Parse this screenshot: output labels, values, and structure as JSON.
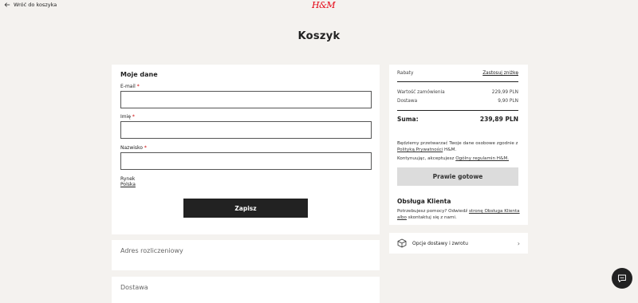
{
  "header": {
    "back_label": "Wróć do koszyka",
    "logo_text": "H&M",
    "page_title": "Koszyk"
  },
  "moje_dane": {
    "title": "Moje dane",
    "email_label": "E-mail",
    "imie_label": "Imię",
    "nazwisko_label": "Nazwisko",
    "required_mark": "*",
    "email_value": "",
    "imie_value": "",
    "nazwisko_value": "",
    "rynek_label": "Rynek",
    "rynek_value": "Polska",
    "save_label": "Zapisz"
  },
  "adres": {
    "title": "Adres rozliczeniowy"
  },
  "dostawa": {
    "title": "Dostawa"
  },
  "summary": {
    "rabaty_label": "Rabaty",
    "rabaty_link": "Zastosuj zniżkę",
    "wartosc_label": "Wartość zamówienia",
    "wartosc_value": "229,99 PLN",
    "dostawa_label": "Dostawa",
    "dostawa_value": "9,90 PLN",
    "suma_label": "Suma:",
    "suma_value": "239,89 PLN",
    "privacy_text": "Będziemy przetwarzać Twoje dane osobowe zgodnie z",
    "privacy_link": "Polityką Prywatności",
    "privacy_suffix": "H&M.",
    "terms_text": "Kontynuując, akceptujesz",
    "terms_link": "Ogólny regulamin H&M.",
    "button_label": "Prawie gotowe"
  },
  "obsluga": {
    "title": "Obsługa Klienta",
    "text_pre": "Potrzebujesz pomocy? Odwiedź",
    "link_1": "stronę Obsługa Klienta",
    "albo": "albo",
    "text_post": "skontaktuj się z nami."
  },
  "opcje": {
    "label": "Opcje dostawy i zwrotu"
  },
  "colors": {
    "brand": "#e50010",
    "dark": "#222222",
    "background": "#f4f2ef"
  }
}
